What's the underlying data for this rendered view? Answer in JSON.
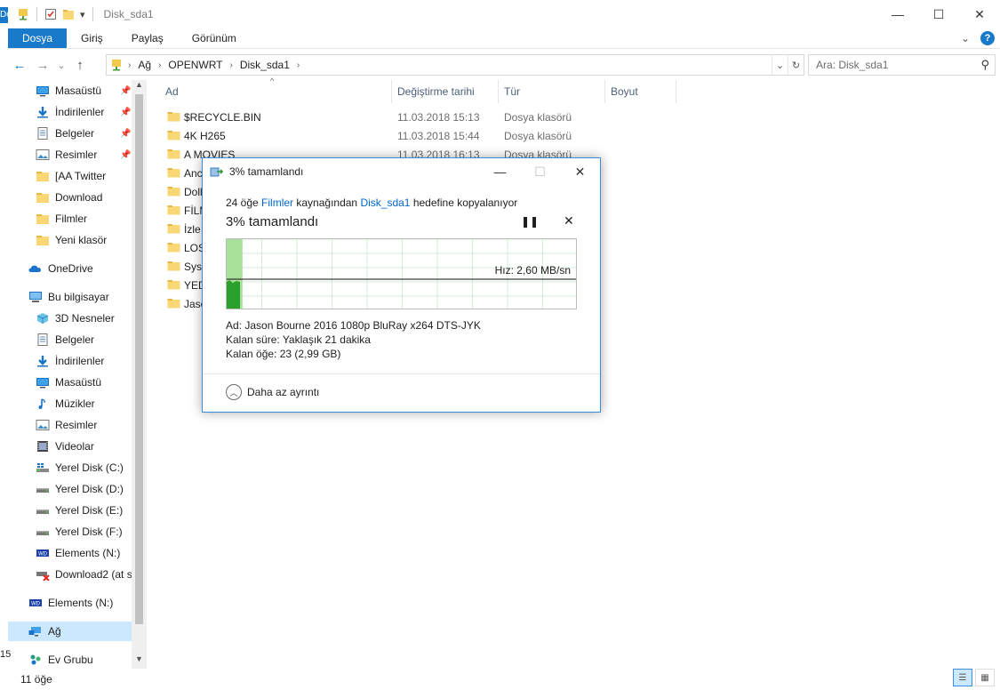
{
  "window": {
    "title": "Disk_sda1",
    "minimize_glyph": "—",
    "maximize_glyph": "☐",
    "close_glyph": "✕"
  },
  "quick_access": {
    "dropdown_glyph": "▾"
  },
  "background_window": {
    "top_text": "Do",
    "bottom_text": "15"
  },
  "ribbon": {
    "tabs": [
      "Dosya",
      "Giriş",
      "Paylaş",
      "Görünüm"
    ],
    "expand_glyph": "⌄",
    "help_glyph": "?"
  },
  "navigation": {
    "back_glyph": "←",
    "forward_glyph": "→",
    "recent_glyph": "⌄",
    "up_glyph": "↑",
    "breadcrumb": [
      "Ağ",
      "OPENWRT",
      "Disk_sda1"
    ],
    "crumb_separator": "›",
    "dropdown_glyph": "⌄",
    "refresh_glyph": "↻",
    "search_placeholder": "Ara: Disk_sda1",
    "search_glyph": "⚲"
  },
  "sidebar": {
    "pin_glyph": "📌",
    "quick_access": [
      {
        "label": "Masaüstü",
        "icon": "desktop-icon",
        "pinned": true
      },
      {
        "label": "İndirilenler",
        "icon": "downloads-icon",
        "pinned": true
      },
      {
        "label": "Belgeler",
        "icon": "documents-icon",
        "pinned": true
      },
      {
        "label": "Resimler",
        "icon": "pictures-icon",
        "pinned": true
      },
      {
        "label": "[AA Twitter",
        "icon": "folder-icon"
      },
      {
        "label": "Download",
        "icon": "folder-icon"
      },
      {
        "label": "Filmler",
        "icon": "folder-icon"
      },
      {
        "label": "Yeni klasör",
        "icon": "folder-icon"
      }
    ],
    "onedrive": "OneDrive",
    "this_pc": "Bu bilgisayar",
    "pc_items": [
      {
        "label": "3D Nesneler",
        "icon": "3d-objects-icon"
      },
      {
        "label": "Belgeler",
        "icon": "documents-icon"
      },
      {
        "label": "İndirilenler",
        "icon": "downloads-icon"
      },
      {
        "label": "Masaüstü",
        "icon": "desktop-icon"
      },
      {
        "label": "Müzikler",
        "icon": "music-icon"
      },
      {
        "label": "Resimler",
        "icon": "pictures-icon"
      },
      {
        "label": "Videolar",
        "icon": "videos-icon"
      },
      {
        "label": "Yerel Disk (C:)",
        "icon": "drive-c-icon"
      },
      {
        "label": "Yerel Disk (D:)",
        "icon": "drive-icon"
      },
      {
        "label": "Yerel Disk (E:)",
        "icon": "drive-icon"
      },
      {
        "label": "Yerel Disk (F:)",
        "icon": "drive-icon"
      },
      {
        "label": "Elements (N:)",
        "icon": "wd-drive-icon"
      },
      {
        "label": "Download2 (at s",
        "icon": "network-drive-disconnected-icon"
      }
    ],
    "elements": "Elements (N:)",
    "network": "Ağ",
    "homegroup": "Ev Grubu",
    "scroll_up_glyph": "▲",
    "scroll_down_glyph": "▼"
  },
  "file_list": {
    "columns": [
      "Ad",
      "Değiştirme tarihi",
      "Tür",
      "Boyut"
    ],
    "sort_glyph": "^",
    "rows": [
      {
        "name": "$RECYCLE.BIN",
        "date": "11.03.2018 15:13",
        "type": "Dosya klasörü"
      },
      {
        "name": "4K H265",
        "date": "11.03.2018 15:44",
        "type": "Dosya klasörü"
      },
      {
        "name": "A MOVIES",
        "date": "11.03.2018 16:13",
        "type": "Dosya klasörü"
      },
      {
        "name": "Anc",
        "date": "",
        "type": ""
      },
      {
        "name": "Doll",
        "date": "",
        "type": ""
      },
      {
        "name": "FİLM",
        "date": "",
        "type": ""
      },
      {
        "name": "İzle",
        "date": "",
        "type": ""
      },
      {
        "name": "LOS",
        "date": "",
        "type": ""
      },
      {
        "name": "Syst",
        "date": "",
        "type": ""
      },
      {
        "name": "YED",
        "date": "",
        "type": ""
      },
      {
        "name": "Jaso",
        "date": "",
        "type": ""
      }
    ]
  },
  "status": {
    "count": "11 öğe",
    "details_view_glyph": "☰",
    "tiles_view_glyph": "▦"
  },
  "copy_dialog": {
    "title": "3%  tamamlandı",
    "min_glyph": "—",
    "max_glyph": "☐",
    "close_glyph": "✕",
    "desc_prefix": "24 öğe ",
    "source": "Filmler",
    "desc_middle": " kaynağından ",
    "destination": "Disk_sda1",
    "desc_suffix": " hedefine kopyalanıyor",
    "percent": "3%  tamamlandı",
    "pause_glyph": "❚❚",
    "cancel_glyph": "✕",
    "speed": "Hız: 2,60 MB/sn",
    "progress_fraction": 0.03,
    "name_line": "Ad:  Jason Bourne 2016 1080p BluRay x264 DTS-JYK",
    "time_line": "Kalan süre:  Yaklaşık 21 dakika",
    "items_line": "Kalan öğe:  23 (2,99 GB)",
    "less_details": "Daha az ayrıntı",
    "less_glyph": "︿"
  }
}
